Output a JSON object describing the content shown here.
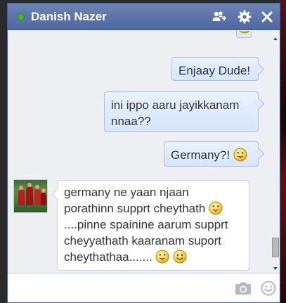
{
  "chat": {
    "contact_name": "Danish Nazer",
    "status": "online",
    "status_color": "#42b72a"
  },
  "messages": [
    {
      "from": "me",
      "text": "Enjaay Dude!"
    },
    {
      "from": "me",
      "text": "ini ippo aaru jayikkanam nnaa??"
    },
    {
      "from": "me",
      "text": "Germany?! ",
      "emojis": [
        "tongue-emoji"
      ]
    },
    {
      "from": "contact",
      "lines": [
        "germany ne yaan njaan",
        "porathinn supprt cheythath ",
        "....pinne spainine aarum supprt",
        "cheyyathath kaaranam suport",
        "cheythathaa....... "
      ],
      "emojis": [
        "tongue-emoji",
        "tongue-emoji",
        "smile-emoji"
      ]
    }
  ],
  "composer": {
    "placeholder": "",
    "value": ""
  },
  "icons": {
    "add_friend": "add-friend-icon",
    "settings": "gear-icon",
    "close": "close-icon",
    "camera": "camera-icon",
    "emoji_picker": "smiley-icon"
  },
  "colors": {
    "titlebar": "#5a73ab",
    "outgoing_bubble": "#dbe8fd",
    "incoming_bubble": "#ffffff"
  }
}
